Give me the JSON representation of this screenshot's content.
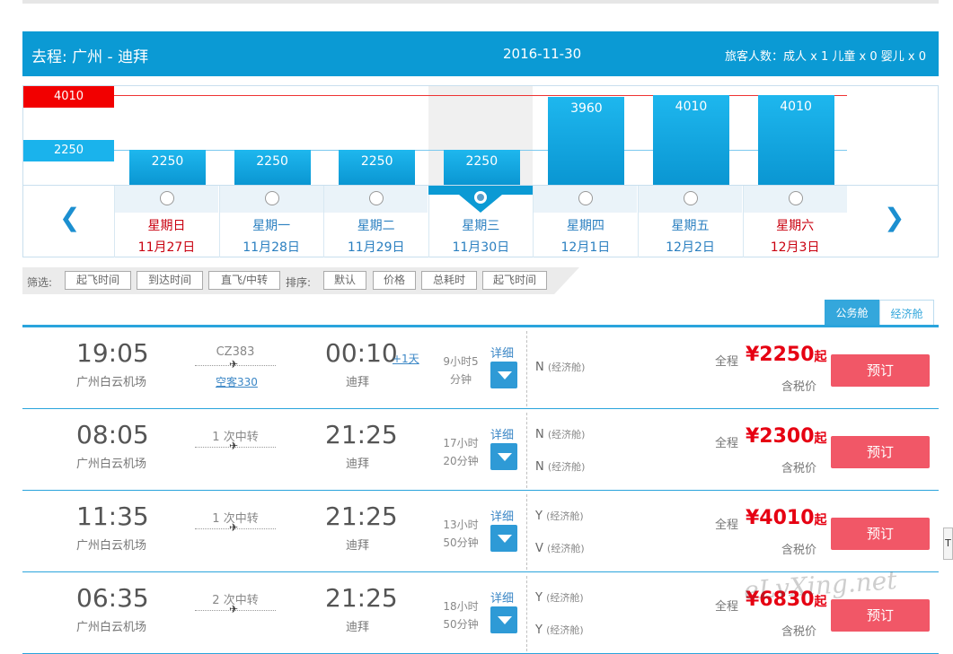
{
  "header": {
    "route": "去程:   广州 - 迪拜",
    "date": "2016-11-30",
    "pax": "旅客人数：成人 x 1    儿童 x 0    婴儿 x 0"
  },
  "calendar": {
    "axis_high": "4010",
    "axis_low": "2250",
    "days": [
      {
        "price": "2250",
        "weekday": "星期日",
        "date": "11月27日",
        "weekend": true,
        "level": 2250
      },
      {
        "price": "2250",
        "weekday": "星期一",
        "date": "11月28日",
        "weekend": false,
        "level": 2250
      },
      {
        "price": "2250",
        "weekday": "星期二",
        "date": "11月29日",
        "weekend": false,
        "level": 2250
      },
      {
        "price": "2250",
        "weekday": "星期三",
        "date": "11月30日",
        "weekend": false,
        "level": 2250,
        "selected": true
      },
      {
        "price": "3960",
        "weekday": "星期四",
        "date": "12月1日",
        "weekend": false,
        "level": 3960
      },
      {
        "price": "4010",
        "weekday": "星期五",
        "date": "12月2日",
        "weekend": false,
        "level": 4010
      },
      {
        "price": "4010",
        "weekday": "星期六",
        "date": "12月3日",
        "weekend": true,
        "level": 4010
      }
    ]
  },
  "filter": {
    "label": "筛选:",
    "sort_label": "排序:",
    "filters": [
      "起飞时间",
      "到达时间",
      "直飞/中转"
    ],
    "sorts": [
      "默认",
      "价格",
      "总耗时",
      "起飞时间"
    ]
  },
  "tabs": {
    "business": "公务舱",
    "economy": "经济舱"
  },
  "flights": [
    {
      "dep": "19:05",
      "dep_airport": "广州白云机场",
      "mid": "CZ383",
      "aircraft": "空客330",
      "arr": "00:10",
      "plus": "+1天",
      "arr_airport": "迪拜",
      "dur1": "9小时5",
      "dur2": "分钟",
      "detail": "详细",
      "cabins": [
        {
          "code": "N",
          "cls": "(经济舱)"
        }
      ],
      "total": "全程",
      "price": "¥2250",
      "qi": "起",
      "tax": "含税价",
      "book": "预订"
    },
    {
      "dep": "08:05",
      "dep_airport": "广州白云机场",
      "mid": "1 次中转",
      "aircraft": "",
      "arr": "21:25",
      "plus": "",
      "arr_airport": "迪拜",
      "dur1": "17小时",
      "dur2": "20分钟",
      "detail": "详细",
      "cabins": [
        {
          "code": "N",
          "cls": "(经济舱)"
        },
        {
          "code": "N",
          "cls": "(经济舱)"
        }
      ],
      "total": "全程",
      "price": "¥2300",
      "qi": "起",
      "tax": "含税价",
      "book": "预订"
    },
    {
      "dep": "11:35",
      "dep_airport": "广州白云机场",
      "mid": "1 次中转",
      "aircraft": "",
      "arr": "21:25",
      "plus": "",
      "arr_airport": "迪拜",
      "dur1": "13小时",
      "dur2": "50分钟",
      "detail": "详细",
      "cabins": [
        {
          "code": "Y",
          "cls": "(经济舱)"
        },
        {
          "code": "V",
          "cls": "(经济舱)"
        }
      ],
      "total": "全程",
      "price": "¥4010",
      "qi": "起",
      "tax": "含税价",
      "book": "预订"
    },
    {
      "dep": "06:35",
      "dep_airport": "广州白云机场",
      "mid": "2 次中转",
      "aircraft": "",
      "arr": "21:25",
      "plus": "",
      "arr_airport": "迪拜",
      "dur1": "18小时",
      "dur2": "50分钟",
      "detail": "详细",
      "cabins": [
        {
          "code": "Y",
          "cls": "(经济舱)"
        },
        {
          "code": "Y",
          "cls": "(经济舱)"
        }
      ],
      "total": "全程",
      "price": "¥6830",
      "qi": "起",
      "tax": "含税价",
      "book": "预订"
    }
  ],
  "watermark": "eLvXing.net",
  "colors": {
    "brand": "#0b9ad4",
    "price": "#e60012",
    "book": "#f15767",
    "weekend": "#c9000f",
    "weekday": "#2a7fc0"
  }
}
